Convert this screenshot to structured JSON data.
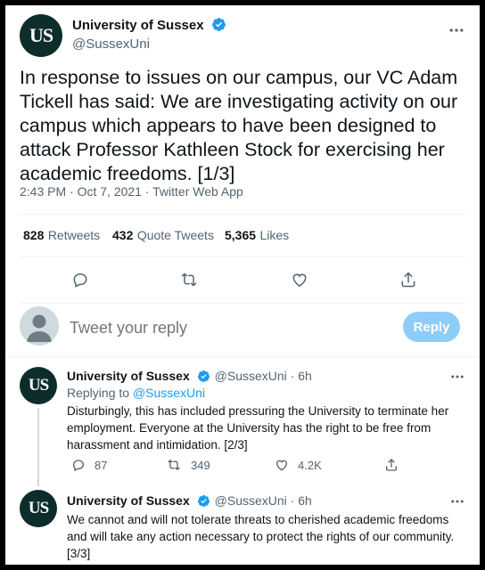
{
  "main_tweet": {
    "avatar_text": "US",
    "name": "University of Sussex",
    "handle": "@SussexUni",
    "text": "In response to issues on our campus, our VC Adam Tickell has said: We are investigating activity on our campus which appears to have been designed to attack Professor Kathleen Stock for exercising her academic freedoms. [1/3]",
    "meta": "2:43 PM · Oct 7, 2021 · Twitter Web App",
    "stats": {
      "retweets_num": "828",
      "retweets_lbl": "Retweets",
      "quotes_num": "432",
      "quotes_lbl": "Quote Tweets",
      "likes_num": "5,365",
      "likes_lbl": "Likes"
    },
    "actions": [
      "reply-icon",
      "retweet-icon",
      "like-icon",
      "share-icon"
    ]
  },
  "composer": {
    "placeholder": "Tweet your reply",
    "button": "Reply"
  },
  "thread": [
    {
      "avatar_text": "US",
      "name": "University of Sussex",
      "handle_time": "@SussexUni · 6h",
      "replying_prefix": "Replying to",
      "replying_handle": "@SussexUni",
      "text": "Disturbingly, this has included pressuring the University to terminate her employment. Everyone at the University has the right to be free from harassment and intimidation. [2/3]",
      "replies": "87",
      "retweets": "349",
      "likes": "4.2K"
    },
    {
      "avatar_text": "US",
      "name": "University of Sussex",
      "handle_time": "@SussexUni · 6h",
      "text": "We cannot and will not tolerate threats to cherished academic freedoms and will take any action necessary to protect the rights of our community. [3/3]"
    }
  ],
  "colors": {
    "avatar_bg": "#0d2d2d",
    "verified": "#1d9bf0",
    "reply_button": "#8ecdf8",
    "link": "#1d9bf0"
  }
}
